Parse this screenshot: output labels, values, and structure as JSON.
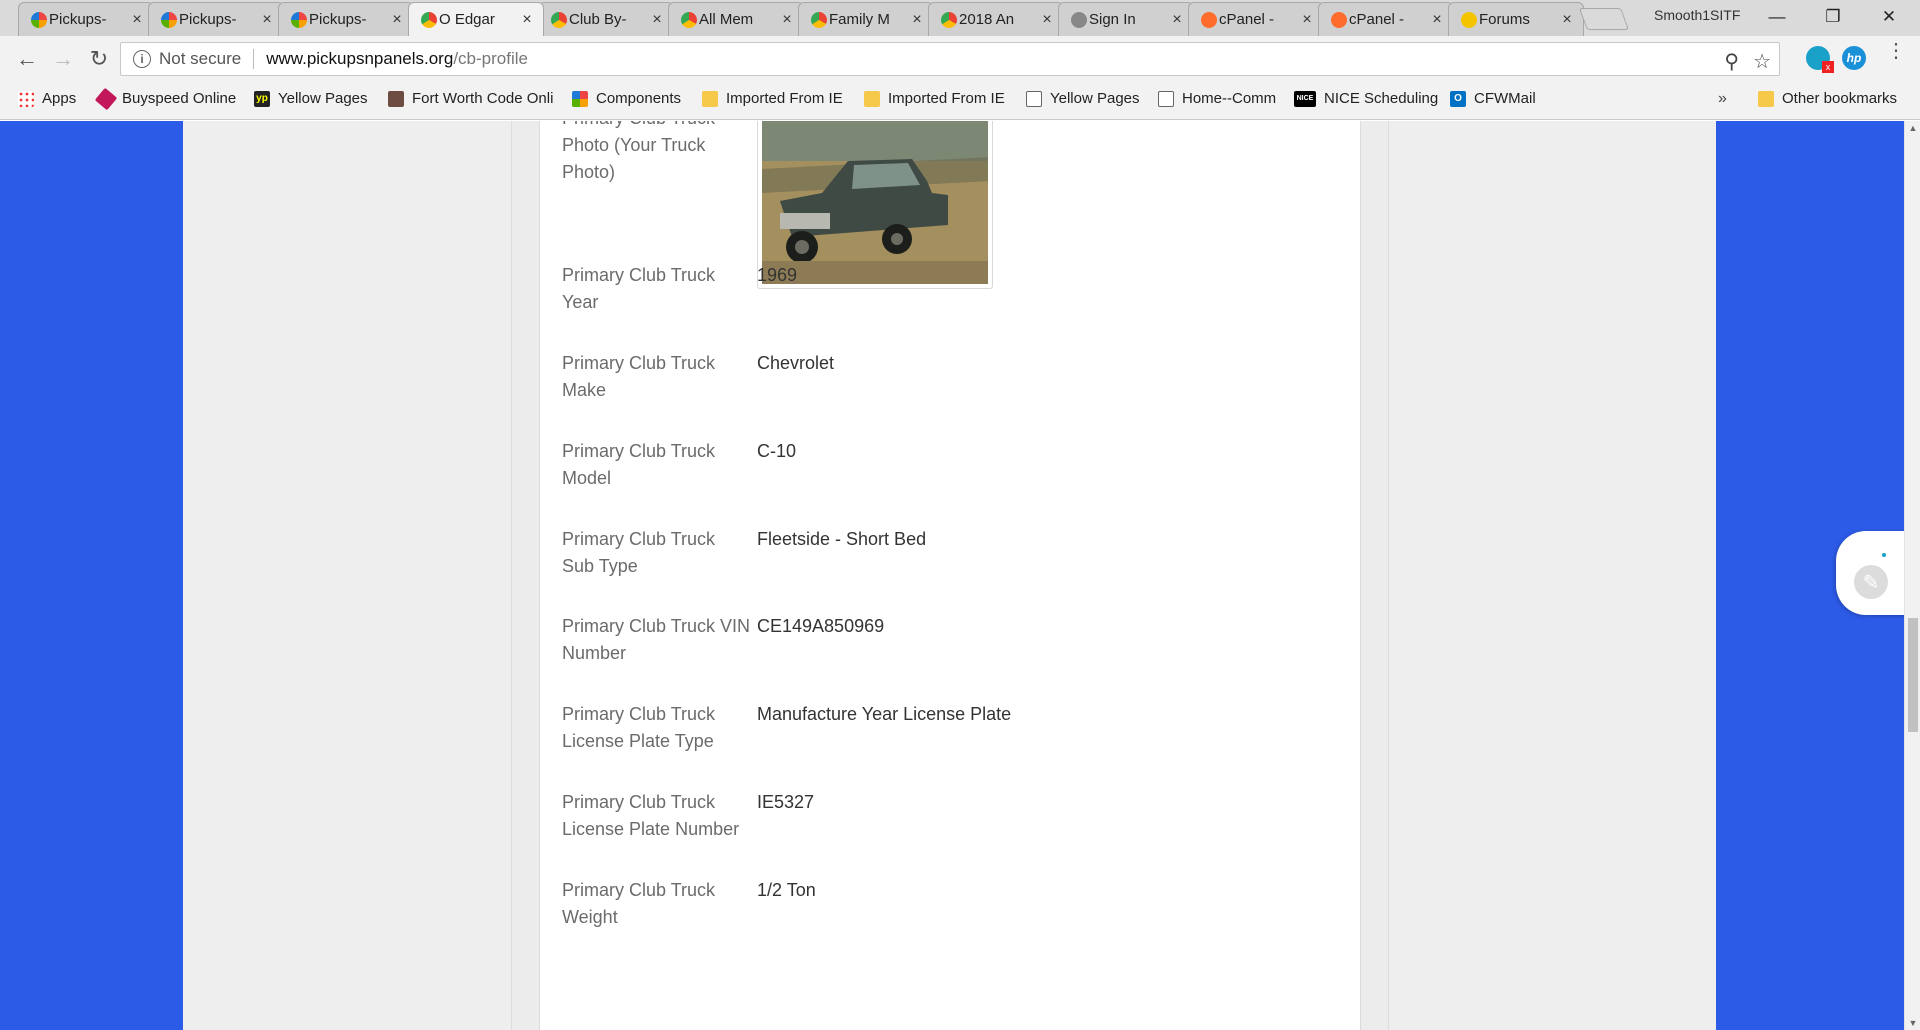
{
  "browser": {
    "tabs": [
      {
        "title": "Pickups-",
        "icon": "joomla-icon"
      },
      {
        "title": "Pickups-",
        "icon": "joomla-icon"
      },
      {
        "title": "Pickups-",
        "icon": "joomla-icon"
      },
      {
        "title": "O Edgar",
        "icon": "chrome-color-icon"
      },
      {
        "title": "Club By-",
        "icon": "chrome-color-icon"
      },
      {
        "title": "All Mem",
        "icon": "chrome-color-icon"
      },
      {
        "title": "Family M",
        "icon": "chrome-color-icon"
      },
      {
        "title": "2018 An",
        "icon": "chrome-color-icon"
      },
      {
        "title": "Sign In",
        "icon": "sign-in-icon"
      },
      {
        "title": "cPanel -",
        "icon": "cpanel-icon"
      },
      {
        "title": "cPanel -",
        "icon": "cpanel-icon"
      },
      {
        "title": "Forums",
        "icon": "forum-icon"
      }
    ],
    "close_glyph": "×",
    "user_name": "Smooth1SITF",
    "window_controls": {
      "minimize": "—",
      "maximize": "❐",
      "close": "✕"
    },
    "nav": {
      "back": "←",
      "forward": "→",
      "reload": "↻"
    },
    "security_label": "Not secure",
    "url_host": "www.pickupsnpanels.org",
    "url_path": "/cb-profile",
    "omnibox_icons": {
      "zoom": "⚲",
      "star": "☆"
    },
    "extensions": {
      "hp_label": "hp",
      "sync_badge": "x"
    },
    "menu_glyph": "⋮"
  },
  "bookmarks": {
    "items": [
      {
        "label": "Apps",
        "icon": "apps-grid-icon"
      },
      {
        "label": "Buyspeed Online",
        "icon": "buyspeed-icon"
      },
      {
        "label": "Yellow Pages",
        "icon": "yp-icon",
        "icon_text": "yp"
      },
      {
        "label": "Fort Worth Code Onli",
        "icon": "fort-worth-icon"
      },
      {
        "label": "Components",
        "icon": "joomla-icon"
      },
      {
        "label": "Imported From IE",
        "icon": "folder-icon"
      },
      {
        "label": "Imported From IE",
        "icon": "folder-icon"
      },
      {
        "label": "Yellow Pages",
        "icon": "page-icon"
      },
      {
        "label": "Home--Comm",
        "icon": "page-icon"
      },
      {
        "label": "NICE Scheduling",
        "icon": "nice-icon",
        "icon_text": "NICE"
      },
      {
        "label": "CFWMail",
        "icon": "outlook-icon",
        "icon_text": "O"
      }
    ],
    "overflow": "»",
    "other_bookmarks": "Other bookmarks"
  },
  "profile": {
    "photo_label": "Primary Club Truck Photo (Your Truck Photo)",
    "photo_alt": "Primary club truck photo",
    "fields": [
      {
        "label": "Primary Club Truck Year",
        "value": "1969"
      },
      {
        "label": "Primary Club Truck Make",
        "value": "Chevrolet"
      },
      {
        "label": "Primary Club Truck Model",
        "value": "C-10"
      },
      {
        "label": "Primary Club Truck Sub Type",
        "value": "Fleetside - Short Bed"
      },
      {
        "label": "Primary Club Truck VIN Number",
        "value": "CE149A850969"
      },
      {
        "label": "Primary Club Truck License Plate Type",
        "value": "Manufacture Year License Plate"
      },
      {
        "label": "Primary Club Truck License Plate Number",
        "value": "IE5327"
      },
      {
        "label": "Primary Club Truck Weight",
        "value": "1/2 Ton"
      }
    ]
  },
  "side_widget": {
    "icon": "pencil-icon",
    "glyph": "✎"
  },
  "scrollbar": {
    "up": "▲",
    "down": "▼"
  },
  "colors": {
    "page_background": "#2c5be8",
    "content_background": "#ffffff",
    "label_color": "#6b6b6b",
    "value_color": "#333333"
  }
}
